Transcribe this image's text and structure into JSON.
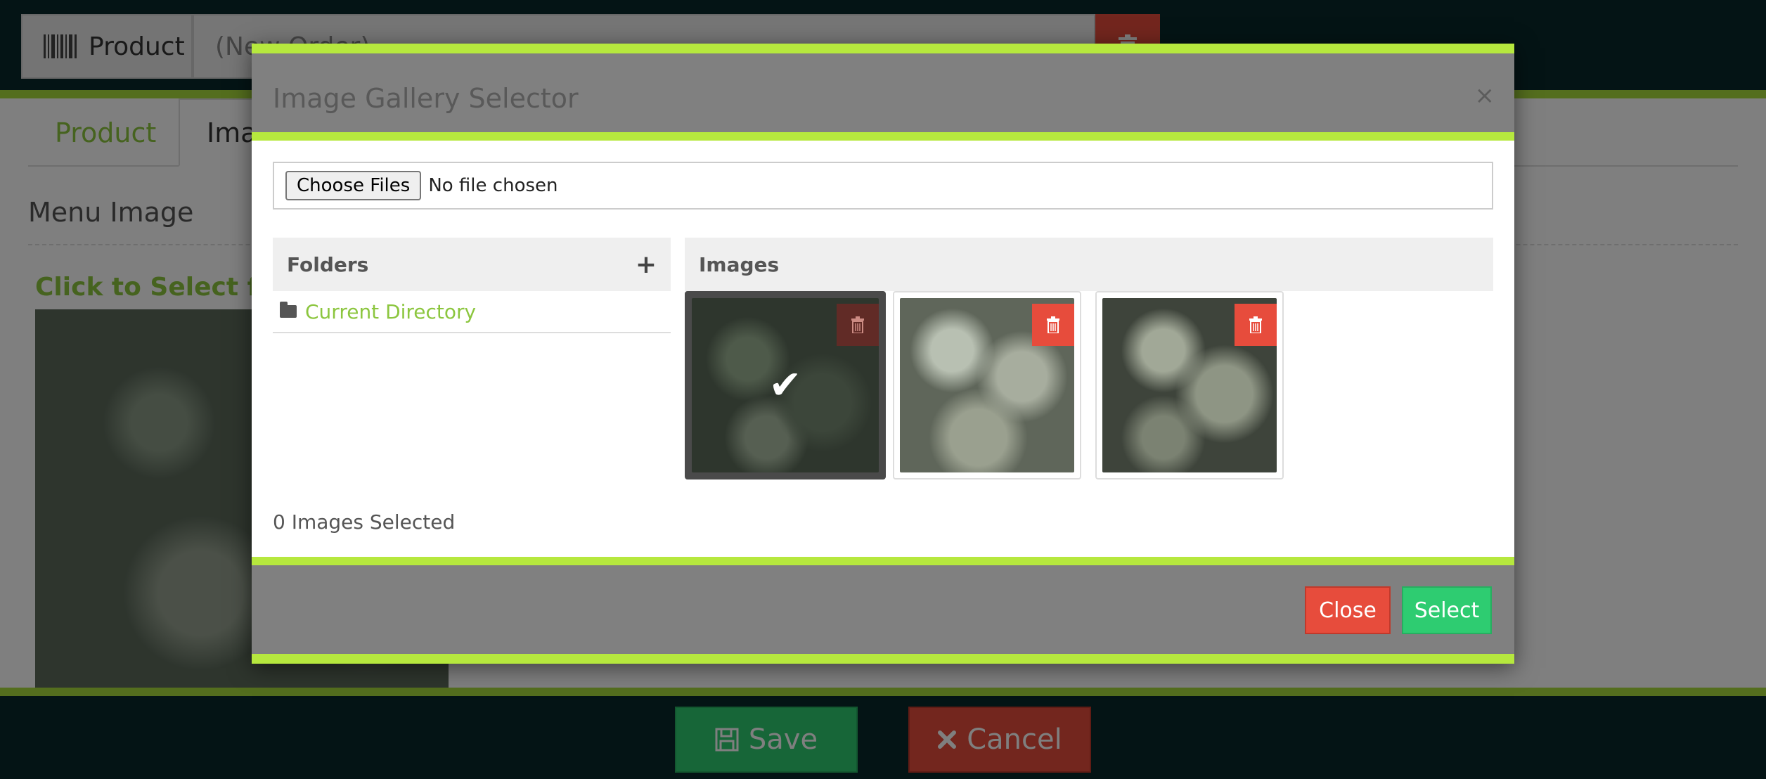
{
  "background": {
    "product_label": "Product",
    "order_value": "(New Order)",
    "tabs": [
      {
        "label": "Product"
      },
      {
        "label": "Images"
      }
    ],
    "menu_image_title": "Menu Image",
    "click_select_label": "Click to Select from Gallery",
    "save_label": "Save",
    "cancel_label": "Cancel"
  },
  "modal": {
    "title": "Image Gallery Selector",
    "close_glyph": "×",
    "file_input": {
      "button_label": "Choose Files",
      "status": "No file chosen"
    },
    "folders": {
      "heading": "Folders",
      "add_glyph": "+",
      "items": [
        {
          "label": "Current Directory"
        }
      ]
    },
    "images": {
      "heading": "Images",
      "items": [
        {
          "selected": true,
          "check_glyph": "✔"
        },
        {
          "selected": false
        },
        {
          "selected": false
        }
      ]
    },
    "selected_count": "0 Images Selected",
    "close_label": "Close",
    "select_label": "Select"
  },
  "colors": {
    "accent": "#b6e83e",
    "link_green": "#8cc63f",
    "danger": "#e74c3c",
    "success": "#2ecc71",
    "dark_bg": "#08282a"
  },
  "icons": [
    "barcode-icon",
    "trash-icon",
    "save-icon",
    "times-icon",
    "folder-icon",
    "plus-icon",
    "check-icon"
  ]
}
